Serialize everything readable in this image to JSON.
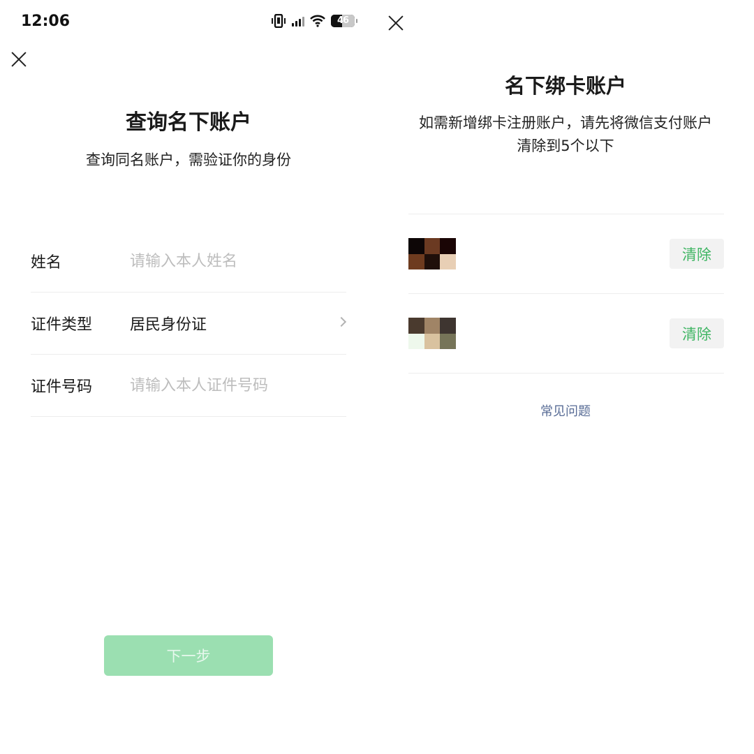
{
  "status_bar": {
    "time": "12:06",
    "battery": "46"
  },
  "left": {
    "title": "查询名下账户",
    "subtitle": "查询同名账户，需验证你的身份",
    "fields": [
      {
        "label": "姓名",
        "placeholder": "请输入本人姓名"
      },
      {
        "label": "证件类型",
        "value": "居民身份证"
      },
      {
        "label": "证件号码",
        "placeholder": "请输入本人证件号码"
      }
    ],
    "next_button": "下一步"
  },
  "right": {
    "title": "名下绑卡账户",
    "description": "如需新增绑卡注册账户，请先将微信支付账户清除到5个以下",
    "accounts": [
      {
        "clear_label": "清除",
        "avatar_colors": [
          "#0d0606",
          "#6b3a22",
          "#1a0505",
          "#6e3b1f",
          "#1f0f0a",
          "#e8cfb5"
        ]
      },
      {
        "clear_label": "清除",
        "avatar_colors": [
          "#4a3a2e",
          "#a08466",
          "#3e3530",
          "#eef8ec",
          "#d9c29f",
          "#767458"
        ]
      }
    ],
    "faq_link": "常见问题"
  }
}
